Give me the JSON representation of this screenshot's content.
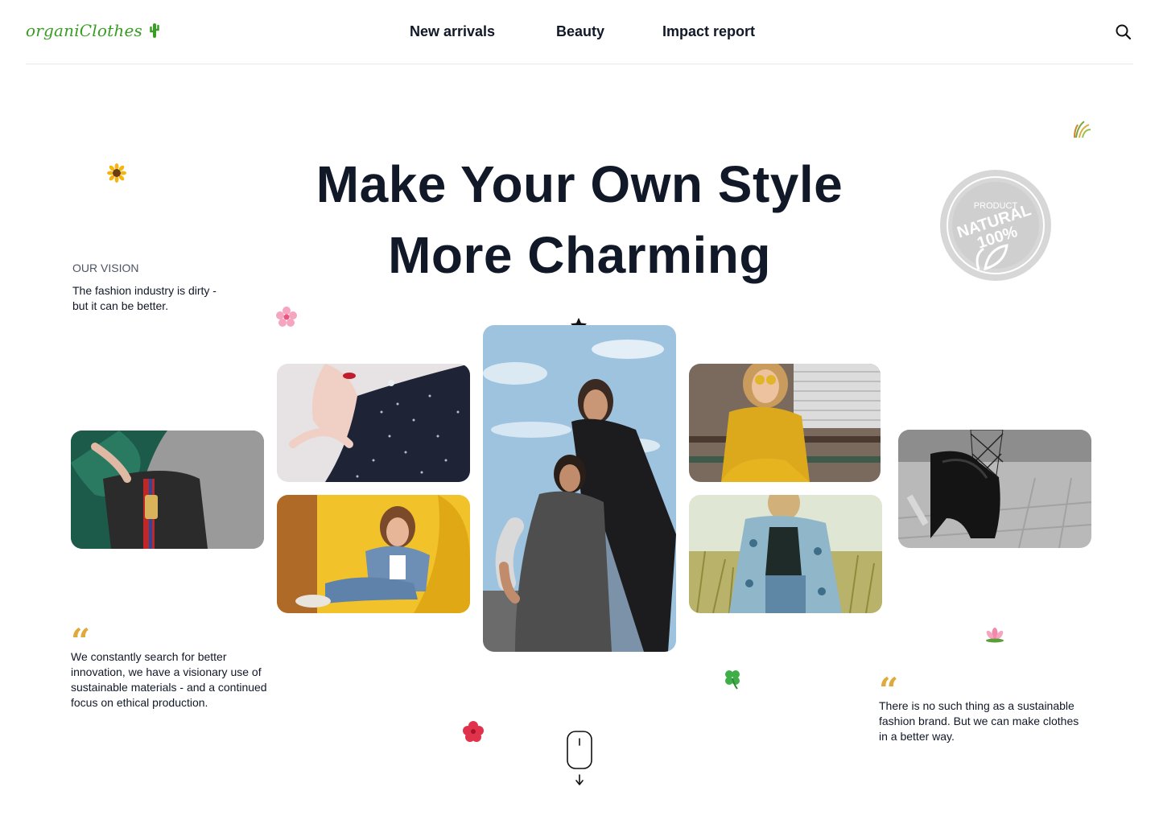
{
  "brand": {
    "name": "organiClothes",
    "color": "#3a9d23"
  },
  "nav": {
    "items": [
      {
        "label": "New arrivals"
      },
      {
        "label": "Beauty"
      },
      {
        "label": "Impact report"
      }
    ]
  },
  "hero": {
    "line1": "Make Your Own Style",
    "line2": "More Charming"
  },
  "vision": {
    "label": "OUR VISION",
    "text": "The fashion industry is dirty - but it can be better."
  },
  "stamp": {
    "line1": "PRODUCT",
    "line2": "NATURAL",
    "line3": "100%"
  },
  "quotes": [
    {
      "mark": "“",
      "text": "We constantly search for better innovation, we have a visionary use of sustainable materials - and a continued focus on ethical production."
    },
    {
      "mark": "“",
      "text": "There is no such thing as a sustainable fashion brand. But we can make clothes in a better way."
    }
  ],
  "icons": {
    "search": "search-icon",
    "scroll": "mouse-scroll-icon",
    "star": "star-icon",
    "quote": "quote-icon"
  },
  "colors": {
    "text": "#111827",
    "accent_quote": "#e0a93b",
    "divider": "#e5e7eb"
  }
}
